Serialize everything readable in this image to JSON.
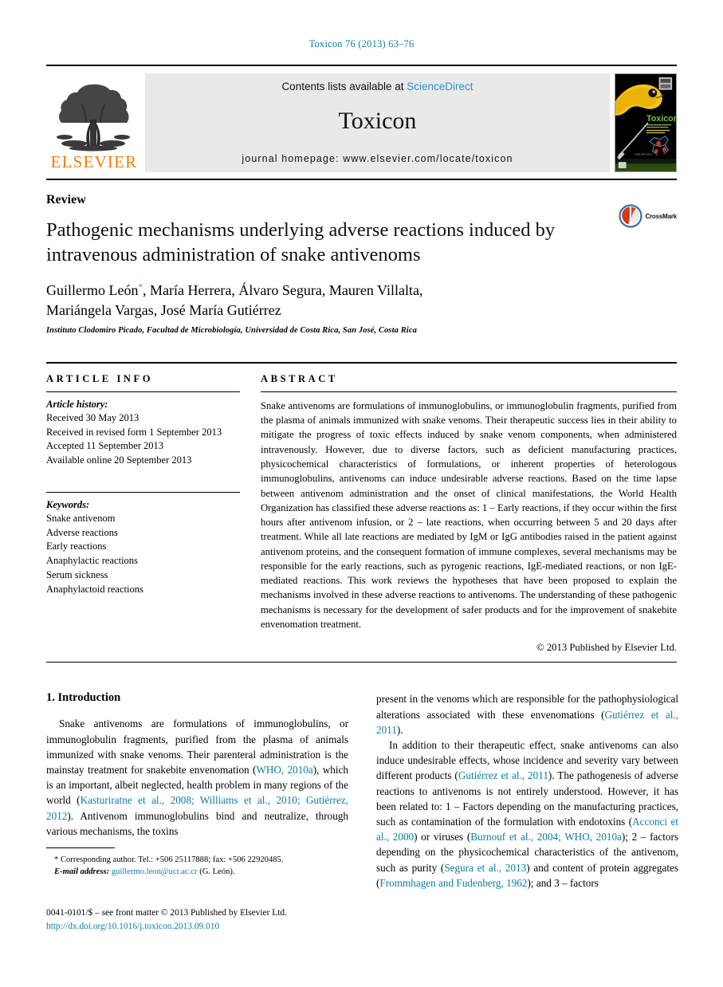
{
  "running_head": "Toxicon 76 (2013) 63–76",
  "masthead": {
    "publisher_name": "ELSEVIER",
    "contents_prefix": "Contents lists available at ",
    "contents_link": "ScienceDirect",
    "journal_name": "Toxicon",
    "homepage": "journal homepage: www.elsevier.com/locate/toxicon",
    "cover_journal_name": "Toxicon",
    "cover_tagline": "An International Journal on the Toxins derived from Animals, Plants and Microorganisms",
    "cover_publisher_mark": "ELSEVIER"
  },
  "title_block": {
    "doctype": "Review",
    "title": "Pathogenic mechanisms underlying adverse reactions induced by intravenous administration of snake antivenoms",
    "authors_line1": "Guillermo León",
    "authors_star": "*",
    "authors_line1_rest": ", María Herrera, Álvaro Segura, Mauren Villalta,",
    "authors_line2": "Mariángela Vargas, José María Gutiérrez",
    "affiliation": "Instituto Clodomiro Picado, Facultad de Microbiología, Universidad de Costa Rica, San José, Costa Rica",
    "crossmark_label": "CrossMark"
  },
  "article_info": {
    "heading": "ARTICLE INFO",
    "history_label": "Article history:",
    "history": [
      "Received 30 May 2013",
      "Received in revised form 1 September 2013",
      "Accepted 11 September 2013",
      "Available online 20 September 2013"
    ],
    "keywords_label": "Keywords:",
    "keywords": [
      "Snake antivenom",
      "Adverse reactions",
      "Early reactions",
      "Anaphylactic reactions",
      "Serum sickness",
      "Anaphylactoid reactions"
    ]
  },
  "abstract": {
    "heading": "ABSTRACT",
    "text": "Snake antivenoms are formulations of immunoglobulins, or immunoglobulin fragments, purified from the plasma of animals immunized with snake venoms. Their therapeutic success lies in their ability to mitigate the progress of toxic effects induced by snake venom components, when administered intravenously. However, due to diverse factors, such as deficient manufacturing practices, physicochemical characteristics of formulations, or inherent properties of heterologous immunoglobulins, antivenoms can induce undesirable adverse reactions. Based on the time lapse between antivenom administration and the onset of clinical manifestations, the World Health Organization has classified these adverse reactions as: 1 – Early reactions, if they occur within the first hours after antivenom infusion, or 2 – late reactions, when occurring between 5 and 20 days after treatment. While all late reactions are mediated by IgM or IgG antibodies raised in the patient against antivenom proteins, and the consequent formation of immune complexes, several mechanisms may be responsible for the early reactions, such as pyrogenic reactions, IgE-mediated reactions, or non IgE-mediated reactions. This work reviews the hypotheses that have been proposed to explain the mechanisms involved in these adverse reactions to antivenoms. The understanding of these pathogenic mechanisms is necessary for the development of safer products and for the improvement of snakebite envenomation treatment.",
    "copyright": "© 2013 Published by Elsevier Ltd."
  },
  "body": {
    "section_heading": "1. Introduction",
    "left_p1_a": "Snake antivenoms are formulations of immunoglobulins, or immunoglobulin fragments, purified from the plasma of animals immunized with snake venoms. Their parenteral administration is the mainstay treatment for snakebite envenomation (",
    "left_ref1": "WHO, 2010a",
    "left_p1_b": "), which is an important, albeit neglected, health problem in many regions of the world (",
    "left_ref2": "Kasturiratne et al., 2008; Williams et al., 2010; Gutiérrez, 2012",
    "left_p1_c": "). Antivenom immunoglobulins bind and neutralize, through various mechanisms, the toxins",
    "right_p1_a": "present in the venoms which are responsible for the pathophysiological alterations associated with these envenomations (",
    "right_ref1": "Gutiérrez et al., 2011",
    "right_p1_b": ").",
    "right_p2_a": "In addition to their therapeutic effect, snake antivenoms can also induce undesirable effects, whose incidence and severity vary between different products (",
    "right_ref2": "Gutiérrez et al., 2011",
    "right_p2_b": "). The pathogenesis of adverse reactions to antivenoms is not entirely understood. However, it has been related to: 1 – Factors depending on the manufacturing practices, such as contamination of the formulation with endotoxins (",
    "right_ref3": "Acconci et al., 2000",
    "right_p2_c": ") or viruses (",
    "right_ref4": "Burnouf et al., 2004; WHO, 2010a",
    "right_p2_d": "); 2 – factors depending on the physicochemical characteristics of the antivenom, such as purity (",
    "right_ref5": "Segura et al., 2013",
    "right_p2_e": ") and content of protein aggregates (",
    "right_ref6": "Frommhagen and Fudenberg, 1962",
    "right_p2_f": "); and 3 – factors"
  },
  "footnotes": {
    "corresponding": "* Corresponding author. Tel.: +506 25117888; fax: +506 22920485.",
    "email_label": "E-mail address:",
    "email": "guillermo.leon@ucr.ac.cr",
    "email_suffix": "(G. León).",
    "imprint": "0041-0101/$ – see front matter © 2013 Published by Elsevier Ltd.",
    "doi": "http://dx.doi.org/10.1016/j.toxicon.2013.09.010"
  },
  "colors": {
    "link_blue": "#0b7cab",
    "sciencedirect_blue": "#2a93c9",
    "elsevier_orange": "#ef7d00",
    "cover_green": "#7ac143"
  }
}
